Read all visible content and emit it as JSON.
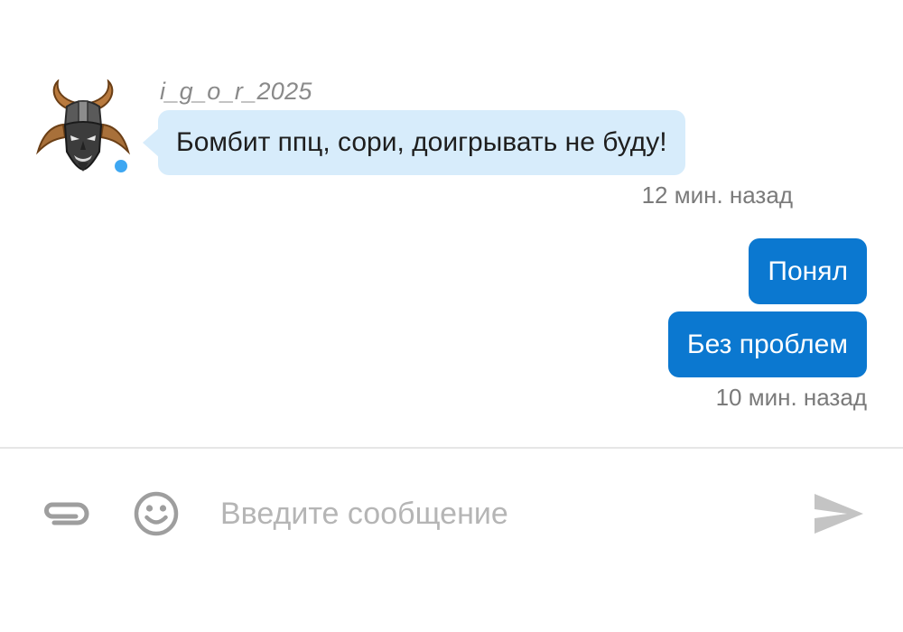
{
  "incoming_message": {
    "username": "i_g_o_r_2025",
    "text": "Бомбит ппц, сори, доигрывать не буду!",
    "time": "12 мин. назад",
    "avatar_icon": "horned-demon-mask-avatar",
    "online_status_color": "#3ea7f2"
  },
  "outgoing_messages": [
    {
      "text": "Понял"
    },
    {
      "text": "Без проблем"
    }
  ],
  "outgoing_time": "10 мин. назад",
  "composer": {
    "placeholder": "Введите сообщение",
    "attach_icon": "paperclip-icon",
    "emoji_icon": "smiley-icon",
    "send_icon": "send-arrow-icon"
  },
  "colors": {
    "incoming_bubble": "#d7ecfb",
    "outgoing_bubble": "#0b78d0",
    "icons": "#9e9e9e"
  }
}
